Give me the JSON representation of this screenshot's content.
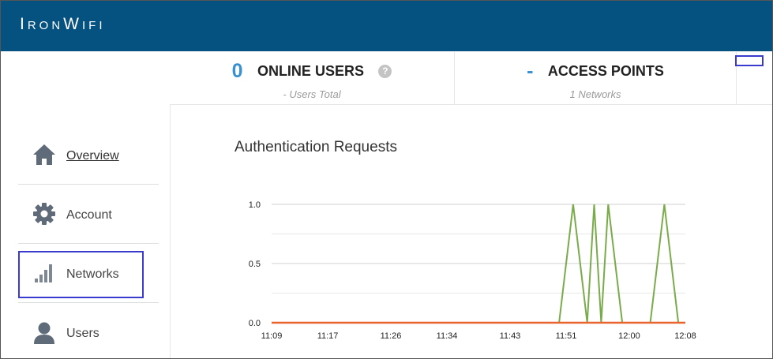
{
  "app": {
    "logo_text": "IronWifi"
  },
  "stats": {
    "online_users": {
      "value": "0",
      "label": "ONLINE USERS",
      "sub": "- Users Total"
    },
    "access_points": {
      "value": "-",
      "label": "ACCESS POINTS",
      "sub": "1 Networks"
    }
  },
  "sidebar": {
    "items": [
      {
        "label": "Overview",
        "icon": "home-icon"
      },
      {
        "label": "Account",
        "icon": "gear-icon"
      },
      {
        "label": "Networks",
        "icon": "signal-bars-icon"
      },
      {
        "label": "Users",
        "icon": "user-icon"
      }
    ]
  },
  "colors": {
    "header": "#05517f",
    "accent": "#3a91cf",
    "highlight": "#3a3acc",
    "series_requests": "#7aab4b",
    "series_baseline": "#e8632e"
  },
  "chart_data": {
    "type": "line",
    "title": "Authentication Requests",
    "xlabel": "",
    "ylabel": "",
    "ylim": [
      0,
      1
    ],
    "yticks": [
      "0.0",
      "0.5",
      "1.0"
    ],
    "xticks": [
      "11:09",
      "11:17",
      "11:26",
      "11:34",
      "11:43",
      "11:51",
      "12:00",
      "12:08"
    ],
    "grid": true,
    "series": [
      {
        "color": "#7aab4b",
        "points": [
          [
            "11:50",
            0
          ],
          [
            "11:52",
            1
          ],
          [
            "11:54",
            0
          ],
          [
            "11:55",
            1
          ],
          [
            "11:56",
            0
          ],
          [
            "11:57",
            1
          ],
          [
            "11:59",
            0
          ],
          [
            "12:03",
            0
          ],
          [
            "12:05",
            1
          ],
          [
            "12:07",
            0
          ]
        ]
      },
      {
        "color": "#e8632e",
        "points": [
          [
            "11:09",
            0
          ],
          [
            "12:08",
            0
          ]
        ]
      }
    ]
  }
}
